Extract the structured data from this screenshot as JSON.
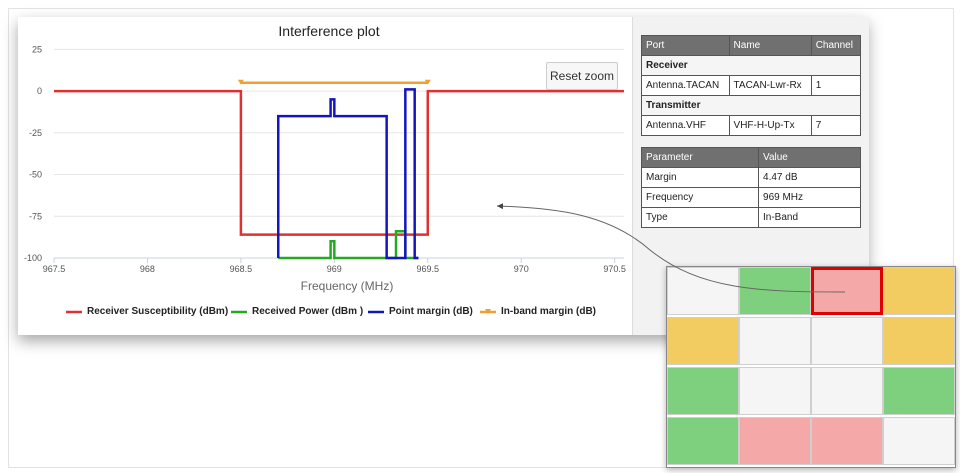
{
  "chart_data": {
    "type": "line",
    "title": "Interference plot",
    "xlabel": "Frequency (MHz)",
    "ylabel": "",
    "xlim": [
      967.5,
      970.55
    ],
    "ylim": [
      -100,
      30
    ],
    "xticks": [
      "967.5",
      "968",
      "968.5",
      "969",
      "969.5",
      "970",
      "970.5"
    ],
    "yticks": [
      "25",
      "0",
      "-25",
      "-50",
      "-75",
      "-100"
    ],
    "xtick_values": [
      967.5,
      968,
      968.5,
      969,
      969.5,
      970,
      970.5
    ],
    "ytick_values": [
      25,
      0,
      -25,
      -50,
      -75,
      -100
    ],
    "grid": "horizontal",
    "legend": "bottom",
    "series": [
      {
        "name": "Receiver Susceptibility (dBm)",
        "color": "#e03030",
        "x": [
          967.5,
          968.5,
          968.5,
          969.5,
          969.5,
          970.55
        ],
        "y": [
          0,
          0,
          -86,
          -86,
          0,
          0
        ]
      },
      {
        "name": "Received Power (dBm )",
        "color": "#22aa22",
        "x": [
          968.7,
          968.98,
          968.98,
          969.0,
          969.0,
          969.33,
          969.33,
          969.38,
          969.38,
          969.45
        ],
        "y": [
          -100,
          -100,
          -90,
          -90,
          -100,
          -100,
          -84,
          -84,
          -100,
          -100
        ]
      },
      {
        "name": "Point margin (dB)",
        "color": "#1515c0",
        "x": [
          968.7,
          968.7,
          968.98,
          968.98,
          969.0,
          969.0,
          969.28,
          969.28,
          969.33,
          969.33,
          969.38,
          969.38,
          969.43,
          969.43,
          969.45,
          969.45
        ],
        "y": [
          -100,
          -15,
          -15,
          -5,
          -5,
          -15,
          -15,
          -100,
          -100,
          -100,
          -100,
          1,
          1,
          -100,
          -100,
          -100
        ]
      },
      {
        "name": "In-band margin (dB)",
        "color": "#f0a030",
        "x": [
          968.5,
          969.5
        ],
        "y": [
          5,
          5
        ]
      }
    ]
  },
  "toolbar": {
    "reset_label": "Reset zoom"
  },
  "connection_table": {
    "headers": [
      "Port",
      "Name",
      "Channel"
    ],
    "receiver_label": "Receiver",
    "receiver": [
      "Antenna.TACAN",
      "TACAN-Lwr-Rx",
      "1"
    ],
    "transmitter_label": "Transmitter",
    "transmitter": [
      "Antenna.VHF",
      "VHF-H-Up-Tx",
      "7"
    ]
  },
  "param_table": {
    "headers": [
      "Parameter",
      "Value"
    ],
    "rows": [
      [
        "Margin",
        "4.47 dB"
      ],
      [
        "Frequency",
        "969 MHz"
      ],
      [
        "Type",
        "In-Band"
      ]
    ]
  },
  "matrix": {
    "cells": [
      [
        "#f5f5f5",
        "#7ed07e",
        "#f4a8a8",
        "#f2cc60"
      ],
      [
        "#f2cc60",
        "#f5f5f5",
        "#f5f5f5",
        "#f2cc60"
      ],
      [
        "#7ed07e",
        "#f5f5f5",
        "#f5f5f5",
        "#7ed07e"
      ],
      [
        "#7ed07e",
        "#f4a8a8",
        "#f4a8a8",
        "#f5f5f5"
      ]
    ],
    "selected": [
      0,
      2
    ]
  }
}
